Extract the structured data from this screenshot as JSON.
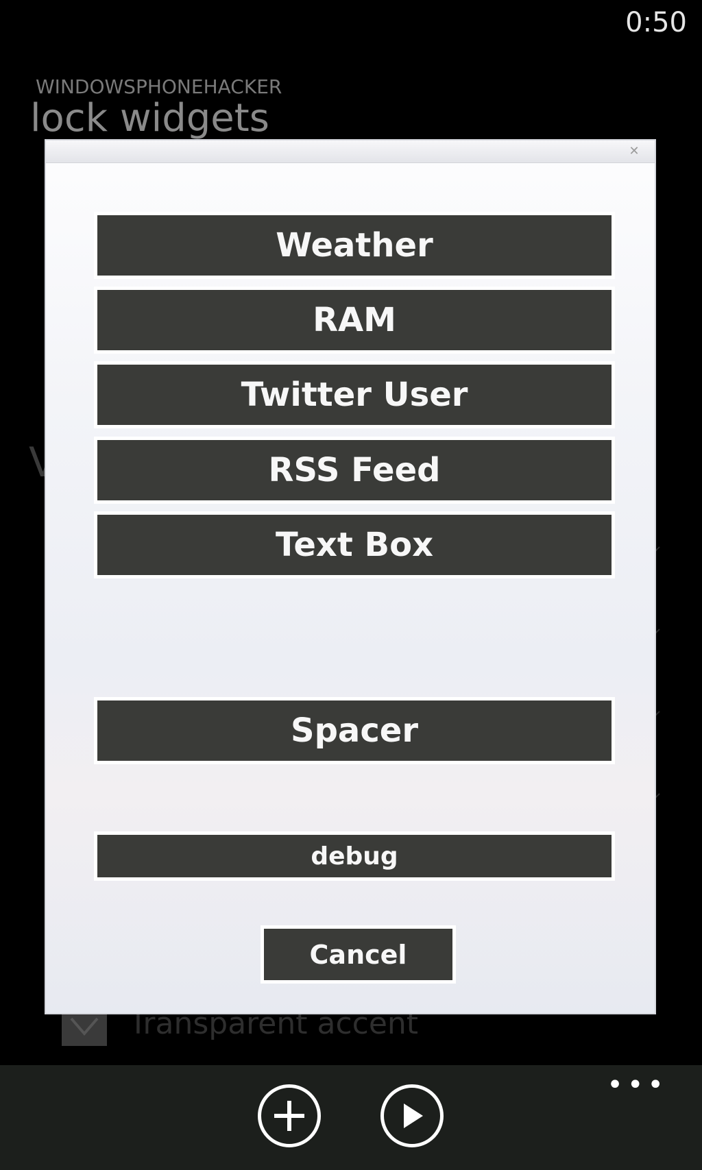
{
  "status": {
    "time": "0:50"
  },
  "app": {
    "name": "WINDOWSPHONEHACKER",
    "page_title": "lock widgets"
  },
  "background": {
    "partial_letter": "V",
    "checkbox_label": "Transparent accent"
  },
  "dialog": {
    "buttons": [
      {
        "label": "Weather"
      },
      {
        "label": "RAM"
      },
      {
        "label": "Twitter User"
      },
      {
        "label": "RSS Feed"
      },
      {
        "label": "Text Box"
      }
    ],
    "spacer_label": "Spacer",
    "debug_label": "debug",
    "cancel_label": "Cancel"
  },
  "appbar": {
    "icons": [
      "add-icon",
      "play-icon"
    ],
    "more_label": "•••"
  }
}
